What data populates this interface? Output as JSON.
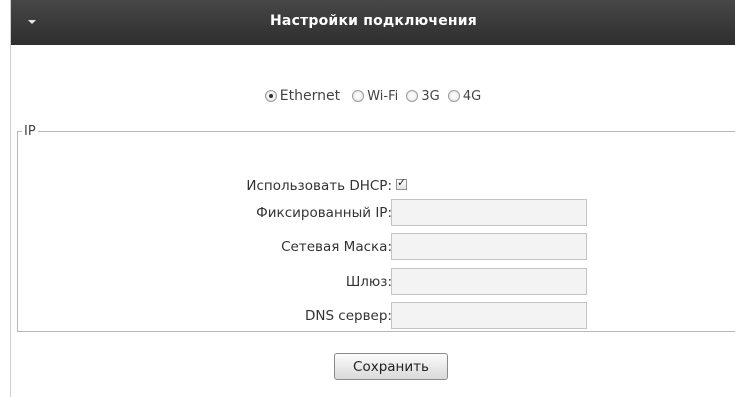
{
  "header": {
    "title": "Настройки подключения"
  },
  "connection_modes": [
    {
      "label": "Ethernet",
      "selected": true
    },
    {
      "label": "Wi-Fi",
      "selected": false
    },
    {
      "label": "3G",
      "selected": false
    },
    {
      "label": "4G",
      "selected": false
    }
  ],
  "ip_section": {
    "legend": "IP",
    "dhcp_label": "Использовать DHCP:",
    "dhcp_checked": true,
    "fields": [
      {
        "label": "Фиксированный IP:",
        "value": ""
      },
      {
        "label": "Сетевая Маска:",
        "value": ""
      },
      {
        "label": "Шлюз:",
        "value": ""
      },
      {
        "label": "DNS сервер:",
        "value": ""
      }
    ]
  },
  "save_label": "Сохранить",
  "icons": {
    "header_toggle": "collapse-arrow-icon"
  }
}
